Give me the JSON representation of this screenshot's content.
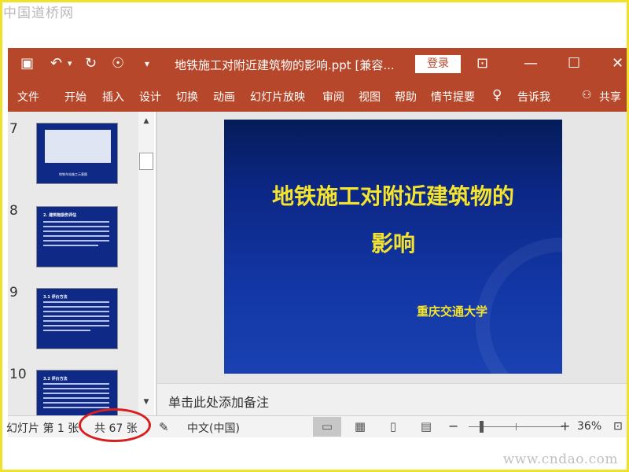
{
  "watermark": {
    "top": "中国道桥网",
    "bottom": "www.cndao.com"
  },
  "titlebar": {
    "title": "地铁施工对附近建筑物的影响.ppt [兼容...",
    "login_label": "登录",
    "save_icon": "▣",
    "undo_icon": "↶",
    "undo_dropdown_icon": "▾",
    "redo_icon": "↻",
    "present_icon": "☉",
    "customize_icon": "▾",
    "ribbon_display_icon": "⊡",
    "minimize_icon": "—",
    "maximize_icon": "☐",
    "close_icon": "✕"
  },
  "ribbon": {
    "tabs": [
      "文件",
      "开始",
      "插入",
      "设计",
      "切换",
      "动画",
      "幻灯片放映",
      "审阅",
      "视图",
      "帮助",
      "情节提要"
    ],
    "tell_me_icon": "♀",
    "tell_me_label": "告诉我",
    "share_icon": "⚇",
    "share_label": "共享"
  },
  "thumbnails": [
    {
      "number": "7",
      "title": "",
      "caption": "地铁车站施工示意图"
    },
    {
      "number": "8",
      "title": "2. 建筑物损伤评估",
      "caption": ""
    },
    {
      "number": "9",
      "title": "3.1 评价方法",
      "caption": ""
    },
    {
      "number": "10",
      "title": "3.2 评价方法",
      "caption": ""
    }
  ],
  "scrollbar": {
    "up_icon": "▲",
    "down_icon": "▼"
  },
  "slide": {
    "title_line1": "地铁施工对附近建筑物的",
    "title_line2": "影响",
    "subtitle": "重庆交通大学"
  },
  "notes": {
    "placeholder": "单击此处添加备注"
  },
  "statusbar": {
    "slide_indicator": "幻灯片 第 1 张",
    "total_count": "共 67 张",
    "notes_icon": "✎",
    "language": "中文(中国)",
    "view_icons": {
      "normal": "▭",
      "sorter": "▦",
      "reading": "▯",
      "slideshow": "▤"
    },
    "zoom_minus": "−",
    "zoom_plus": "+",
    "zoom_percent": "36%",
    "zoom_level": 0.36,
    "fit_icon": "⊡"
  },
  "colors": {
    "accent": "#b7472a",
    "slide_text": "#f5e42e",
    "highlight": "#d71f1f"
  }
}
